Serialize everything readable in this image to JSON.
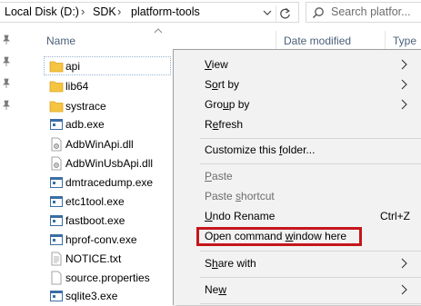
{
  "address": {
    "crumbs": [
      "Local Disk (D:)",
      "SDK",
      "platform-tools"
    ],
    "separator": "›"
  },
  "search": {
    "placeholder": "Search platfor..."
  },
  "columns": {
    "name": "Name",
    "date_modified": "Date modified",
    "type": "Type"
  },
  "files": [
    {
      "name": "api",
      "icon": "folder-icon"
    },
    {
      "name": "lib64",
      "icon": "folder-icon"
    },
    {
      "name": "systrace",
      "icon": "folder-icon"
    },
    {
      "name": "adb.exe",
      "icon": "exe-icon"
    },
    {
      "name": "AdbWinApi.dll",
      "icon": "dll-icon"
    },
    {
      "name": "AdbWinUsbApi.dll",
      "icon": "dll-icon"
    },
    {
      "name": "dmtracedump.exe",
      "icon": "exe-icon"
    },
    {
      "name": "etc1tool.exe",
      "icon": "exe-icon"
    },
    {
      "name": "fastboot.exe",
      "icon": "exe-icon"
    },
    {
      "name": "hprof-conv.exe",
      "icon": "exe-icon"
    },
    {
      "name": "NOTICE.txt",
      "icon": "text-file-icon"
    },
    {
      "name": "source.properties",
      "icon": "file-icon"
    },
    {
      "name": "sqlite3.exe",
      "icon": "exe-icon"
    }
  ],
  "context_menu": {
    "view": {
      "pre": "",
      "key": "V",
      "post": "iew"
    },
    "sort_by": {
      "pre": "S",
      "key": "o",
      "post": "rt by"
    },
    "group_by": {
      "pre": "Gro",
      "key": "u",
      "post": "p by"
    },
    "refresh": {
      "pre": "R",
      "key": "e",
      "post": "fresh"
    },
    "customize": {
      "pre": "Customize this ",
      "key": "f",
      "post": "older..."
    },
    "paste": {
      "pre": "",
      "key": "P",
      "post": "aste"
    },
    "paste_shortcut": {
      "pre": "Paste ",
      "key": "s",
      "post": "hortcut"
    },
    "undo_rename": {
      "pre": "",
      "key": "U",
      "post": "ndo Rename"
    },
    "undo_shortcut": "Ctrl+Z",
    "open_cmd": {
      "pre": "Open command ",
      "key": "w",
      "post": "indow here"
    },
    "share_with": {
      "pre": "S",
      "key": "h",
      "post": "are with"
    },
    "new": {
      "pre": "Ne",
      "key": "w",
      "post": ""
    }
  },
  "colors": {
    "highlight": "#c4161c",
    "folder": "#f5c542",
    "menu_bg": "#f2f2f2"
  }
}
